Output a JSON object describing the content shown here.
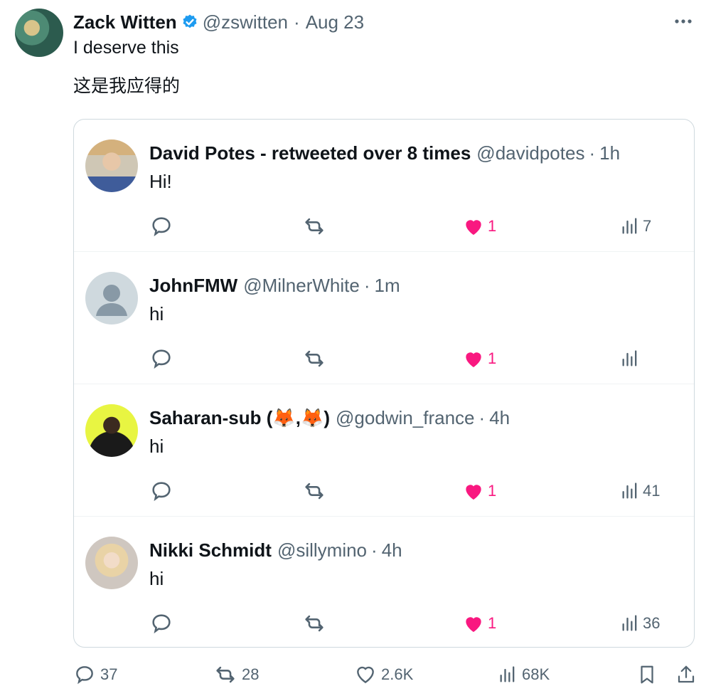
{
  "tweet": {
    "author_name": "Zack Witten",
    "handle": "@zswitten",
    "separator": "·",
    "date": "Aug 23",
    "text_line1": "I deserve this",
    "text_line2": "这是我应得的",
    "avatar_icon": "painted-avatar",
    "verified_icon": "verified-badge-icon",
    "more_icon": "more-icon"
  },
  "replies": [
    {
      "name": "David Potes - retweeted over 8 times",
      "handle": "@davidpotes",
      "time": "1h",
      "text": "Hi!",
      "likes": "1",
      "views": "7"
    },
    {
      "name": "JohnFMW",
      "handle": "@MilnerWhite",
      "time": "1m",
      "text": "hi",
      "likes": "1",
      "views": ""
    },
    {
      "name": "Saharan-sub (🦊,🦊)",
      "handle": "@godwin_france",
      "time": "4h",
      "text": "hi",
      "likes": "1",
      "views": "41"
    },
    {
      "name": "Nikki Schmidt",
      "handle": "@sillymino",
      "time": "4h",
      "text": "hi",
      "likes": "1",
      "views": "36"
    }
  ],
  "stats": {
    "replies": "37",
    "retweets": "28",
    "likes": "2.6K",
    "views": "68K"
  },
  "colors": {
    "like_active": "#f91880",
    "verified": "#1d9bf0",
    "muted": "#536471",
    "border": "#cfd9de"
  }
}
